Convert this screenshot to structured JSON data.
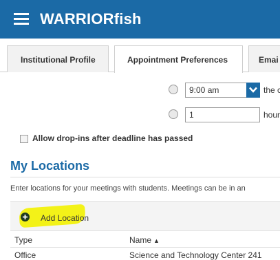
{
  "header": {
    "app_title": "WARRIORfish",
    "menu_icon": "hamburger-menu-icon",
    "background": "#1b6aa6"
  },
  "tabs": [
    {
      "label": "Institutional Profile",
      "active": false
    },
    {
      "label": "Appointment Preferences",
      "active": true
    },
    {
      "label": "Emai",
      "active": false
    }
  ],
  "deadline": {
    "time_value": "9:00 am",
    "time_suffix": "the c",
    "hours_value": "1",
    "hours_suffix": "hour"
  },
  "dropins": {
    "label": "Allow drop-ins after deadline has passed",
    "checked": false
  },
  "locations": {
    "heading": "My Locations",
    "intro": "Enter locations for your meetings with students. Meetings can be in an",
    "add_label": "Add Location",
    "add_icon": "plus-circle-icon",
    "highlight_color": "#f3f200",
    "columns": {
      "type": "Type",
      "name": "Name",
      "name_sort": "▲"
    },
    "rows": [
      {
        "type": "Office",
        "name": "Science and Technology Center 241"
      }
    ]
  }
}
